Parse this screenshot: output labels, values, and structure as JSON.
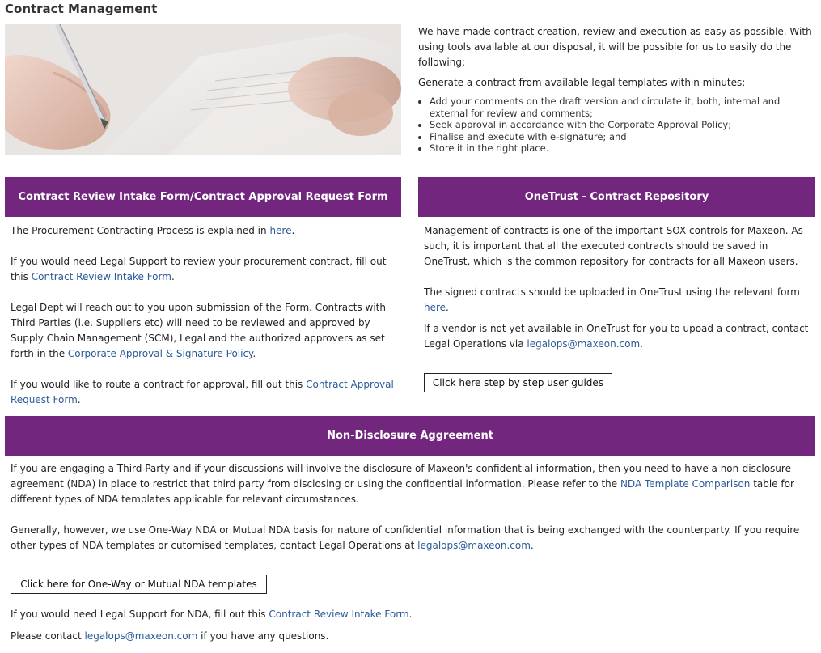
{
  "page": {
    "title": "Contract Management"
  },
  "intro": {
    "paragraph": "We have made contract creation, review and execution as easy as possible. With using tools available at our disposal, it will be possible for us to easily do the following:",
    "lead": "Generate a contract from available legal templates within minutes:",
    "bullets": [
      "Add your comments on the draft version and circulate it, both, internal and external for review and comments;",
      "Seek approval in accordance with the Corporate Approval Policy;",
      "Finalise and execute with e-signature; and",
      "Store it in the right place."
    ]
  },
  "left_section": {
    "header": "Contract Review Intake Form/Contract Approval Request Form",
    "p1_text": "The Procurement Contracting Process is explained in ",
    "p1_link": "here",
    "p1_end": ".",
    "p2_text": "If you would need Legal Support to review your procurement contract, fill out this ",
    "p2_link": "Contract Review Intake Form",
    "p2_end": ".",
    "p3_text": "Legal Dept will reach out to you upon submission of the Form. Contracts with Third Parties (i.e. Suppliers etc) will need to be reviewed and approved by Supply Chain Management (SCM), Legal and the authorized approvers as set forth in the ",
    "p3_link": "Corporate Approval & Signature Policy",
    "p3_end": ".",
    "p4_text": "If you would like to route a contract for approval, fill out this ",
    "p4_link": "Contract Approval Request Form",
    "p4_end": "."
  },
  "right_section": {
    "header": "OneTrust - Contract Repository",
    "p1": "Management of contracts is one of the important SOX controls for Maxeon. As such, it is important that all the executed contracts should be saved in OneTrust, which is the common repository for contracts for all Maxeon users.",
    "p2_text": "The signed contracts should be uploaded in OneTrust using the relevant form ",
    "p2_link": "here",
    "p2_end": ".",
    "p3_text": "If a vendor is not yet available in OneTrust for you to upoad a contract, contact Legal Operations via ",
    "p3_link": "legalops@maxeon.com",
    "p3_end": ".",
    "button": "Click here step by step user guides"
  },
  "nda_section": {
    "header": "Non-Disclosure Aggreement",
    "p1_text": "If you are engaging a Third Party and if your discussions will involve the disclosure of Maxeon's confidential information, then you need to have a non-disclosure agreement (NDA) in place to restrict that third party from disclosing or using the confidential information. Please refer to the ",
    "p1_link": "NDA Template Comparison",
    "p1_end": " table for different types of NDA templates applicable for relevant circumstances.",
    "p2_text": "Generally, however, we use One-Way NDA or Mutual NDA basis for nature of confidential information that is being exchanged with the counterparty.  If you require other types of NDA templates or cutomised templates, contact Legal Operations at ",
    "p2_link": "legalops@maxeon.com",
    "p2_end": ".",
    "button": "Click here for One-Way or Mutual NDA templates",
    "p3_text": "If you would need Legal Support for NDA, fill out this ",
    "p3_link": "Contract Review Intake Form",
    "p3_end": ".",
    "p4_text": "Please contact ",
    "p4_link": "legalops@maxeon.com",
    "p4_end": " if you have any questions."
  },
  "colors": {
    "section_header_bg": "#72267e",
    "link": "#2b5a97"
  },
  "image": {
    "subject": "hand-writing-on-document-photo"
  }
}
